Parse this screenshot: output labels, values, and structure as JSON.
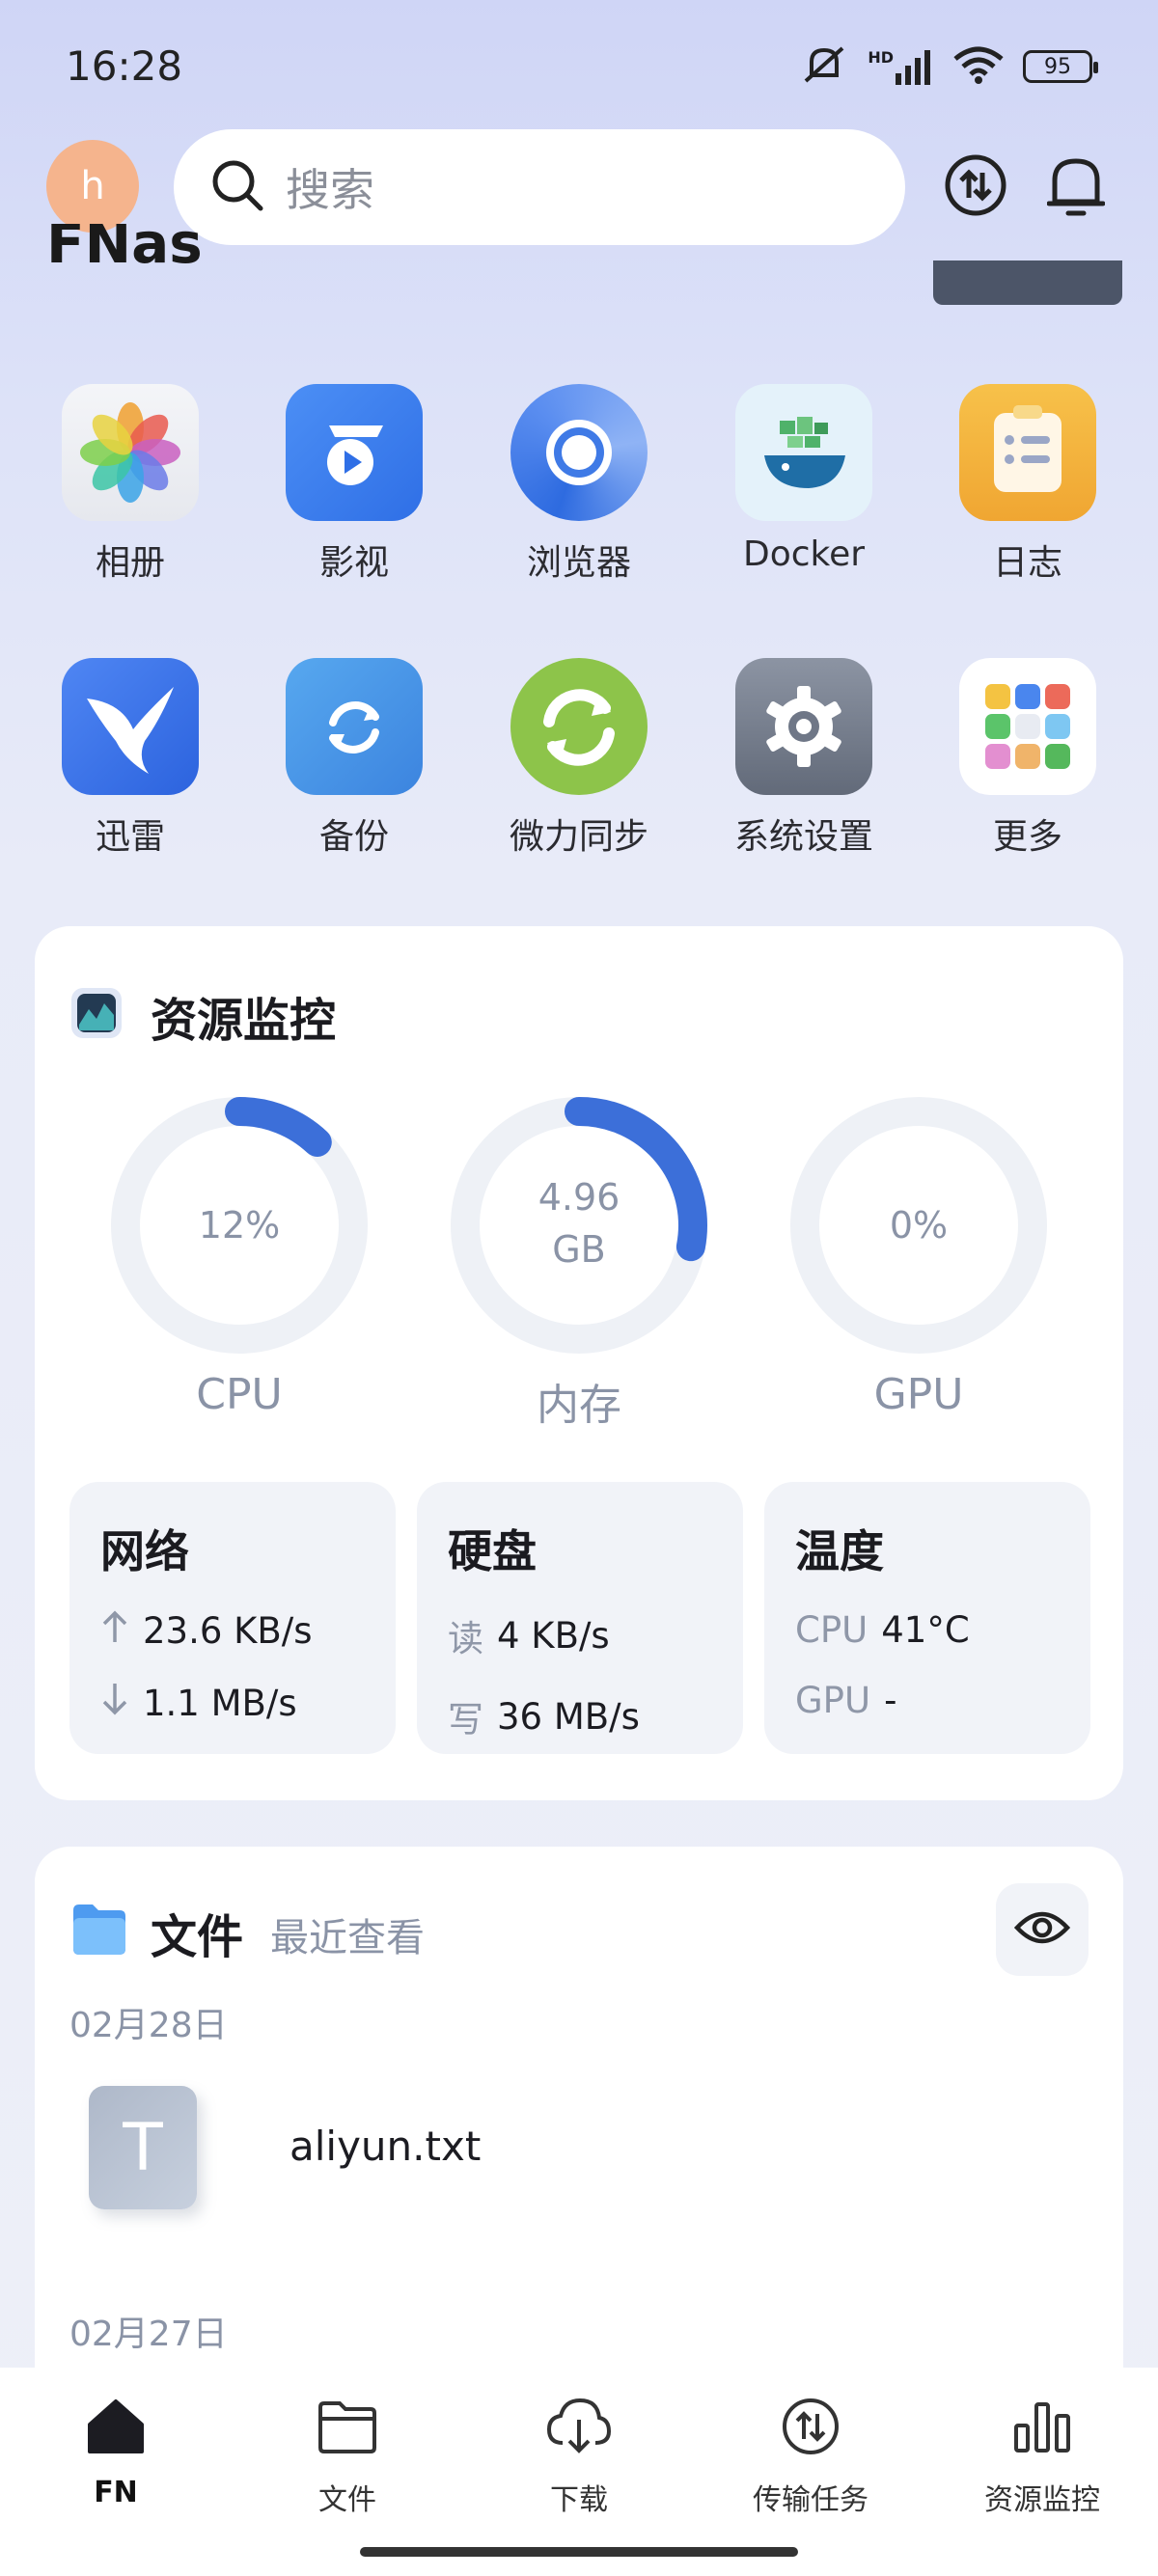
{
  "status_bar": {
    "time": "16:28",
    "battery": "95",
    "network": "HD"
  },
  "header": {
    "avatar_letter": "h",
    "search_placeholder": "搜索",
    "partial_title": "FNas"
  },
  "apps": [
    {
      "label": "相册",
      "icon": "photos-icon"
    },
    {
      "label": "影视",
      "icon": "video-icon"
    },
    {
      "label": "浏览器",
      "icon": "browser-icon"
    },
    {
      "label": "Docker",
      "icon": "docker-icon"
    },
    {
      "label": "日志",
      "icon": "log-icon"
    },
    {
      "label": "迅雷",
      "icon": "thunder-icon"
    },
    {
      "label": "备份",
      "icon": "backup-icon"
    },
    {
      "label": "微力同步",
      "icon": "sync-icon"
    },
    {
      "label": "系统设置",
      "icon": "settings-icon"
    },
    {
      "label": "更多",
      "icon": "more-icon"
    }
  ],
  "monitor": {
    "title": "资源监控",
    "gauges": [
      {
        "label": "CPU",
        "value": "12%",
        "fraction": 0.12
      },
      {
        "label": "内存",
        "value_line1": "4.96",
        "value_line2": "GB",
        "fraction": 0.28
      },
      {
        "label": "GPU",
        "value": "0%",
        "fraction": 0
      }
    ],
    "network": {
      "title": "网络",
      "up": "23.6 KB/s",
      "down": "1.1 MB/s"
    },
    "disk": {
      "title": "硬盘",
      "read_key": "读",
      "read": "4 KB/s",
      "write_key": "写",
      "write": "36 MB/s"
    },
    "temperature": {
      "title": "温度",
      "cpu_key": "CPU",
      "cpu": "41°C",
      "gpu_key": "GPU",
      "gpu": "-"
    }
  },
  "files": {
    "title": "文件",
    "subtitle": "最近查看",
    "groups": [
      {
        "date": "02月28日",
        "items": [
          {
            "name": "aliyun.txt",
            "type_letter": "T"
          }
        ]
      },
      {
        "date": "02月27日",
        "items": []
      }
    ]
  },
  "nav": [
    {
      "label": "FN",
      "icon": "home-icon",
      "active": true
    },
    {
      "label": "文件",
      "icon": "folder-icon",
      "active": false
    },
    {
      "label": "下载",
      "icon": "download-icon",
      "active": false
    },
    {
      "label": "传输任务",
      "icon": "transfer-icon",
      "active": false
    },
    {
      "label": "资源监控",
      "icon": "monitor-icon",
      "active": false
    }
  ],
  "colors": {
    "accent": "#3c6fd9",
    "gauge_track": "#eef1f6",
    "muted_text": "#8a93a6"
  }
}
